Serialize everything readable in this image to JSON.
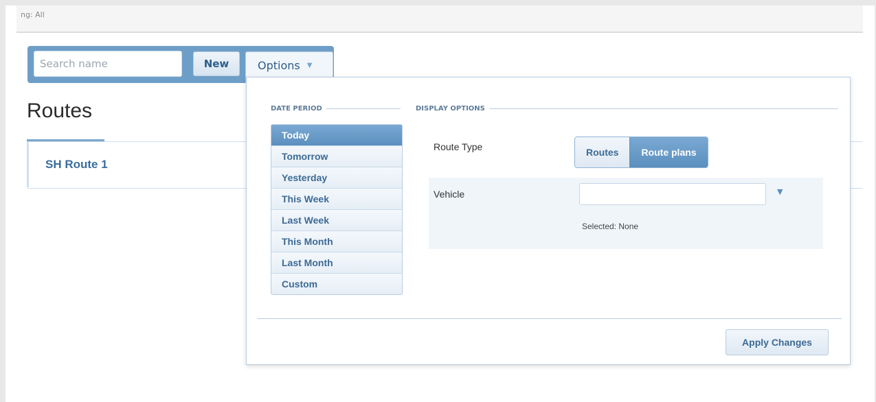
{
  "topbar": {
    "text": "ng: All"
  },
  "toolbar": {
    "search_placeholder": "Search name",
    "new_label": "New",
    "options_label": "Options",
    "options_caret": "▼"
  },
  "page": {
    "title": "Routes",
    "items": [
      {
        "label": "SH Route 1"
      }
    ]
  },
  "options_panel": {
    "date_period": {
      "heading": "DATE PERIOD",
      "selected": "Today",
      "items": [
        "Today",
        "Tomorrow",
        "Yesterday",
        "This Week",
        "Last Week",
        "This Month",
        "Last Month",
        "Custom"
      ]
    },
    "display_options": {
      "heading": "DISPLAY OPTIONS",
      "route_type_label": "Route Type",
      "route_type_options": [
        "Routes",
        "Route plans"
      ],
      "route_type_selected": "Route plans",
      "vehicle_label": "Vehicle",
      "vehicle_value": "",
      "vehicle_caret": "▼",
      "selected_text": "Selected: None"
    },
    "apply_label": "Apply Changes"
  },
  "colors": {
    "accent": "#6d9ec8",
    "active": "#5b8fbe",
    "link": "#3a6d9e"
  }
}
